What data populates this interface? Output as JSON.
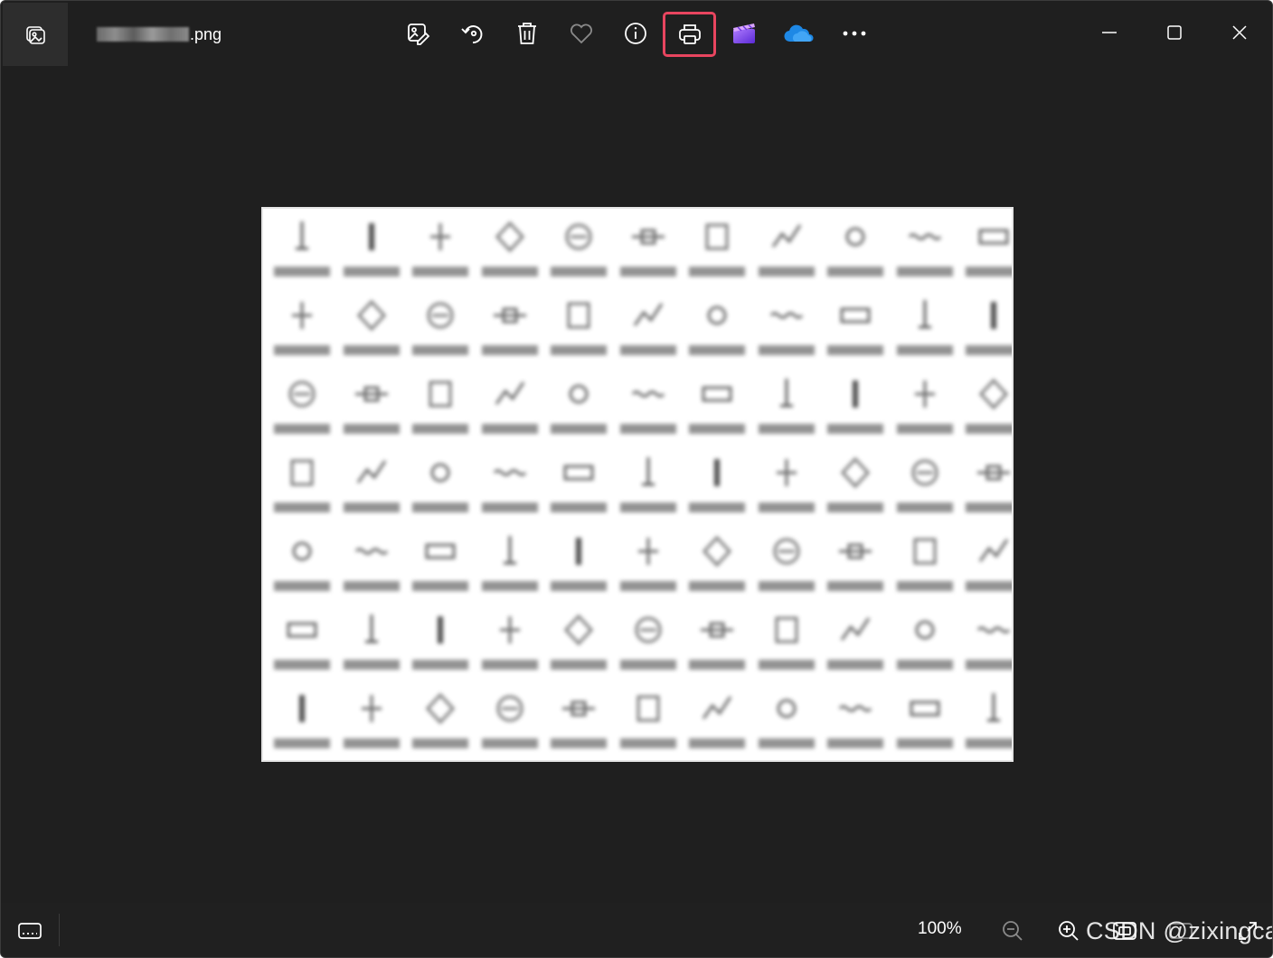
{
  "titlebar": {
    "app_icon": "photos-app-icon",
    "filename_suffix": ".png",
    "toolbar": [
      {
        "name": "edit-image-button",
        "icon": "edit-image-icon"
      },
      {
        "name": "rotate-button",
        "icon": "rotate-icon"
      },
      {
        "name": "delete-button",
        "icon": "trash-icon"
      },
      {
        "name": "favorite-button",
        "icon": "heart-icon"
      },
      {
        "name": "file-info-button",
        "icon": "info-icon"
      },
      {
        "name": "print-button",
        "icon": "printer-icon",
        "highlighted": true
      },
      {
        "name": "clipchamp-button",
        "icon": "clipchamp-icon"
      },
      {
        "name": "onedrive-button",
        "icon": "onedrive-icon"
      },
      {
        "name": "more-options-button",
        "icon": "ellipsis-icon"
      }
    ],
    "window_controls": [
      "minimize-icon",
      "maximize-icon",
      "close-icon"
    ]
  },
  "bottombar": {
    "zoom_level": "100%",
    "icons": [
      "filmstrip-icon",
      "zoom-out-icon",
      "zoom-in-icon",
      "fit-to-window-icon",
      "fullscreen-icon"
    ],
    "watermark": "CSDN @zixingcai"
  },
  "colors": {
    "window_bg": "#1f1f1f",
    "highlight": "#e8455f",
    "onedrive": "#1e88e5",
    "clipchamp": "#8e5cf0"
  }
}
